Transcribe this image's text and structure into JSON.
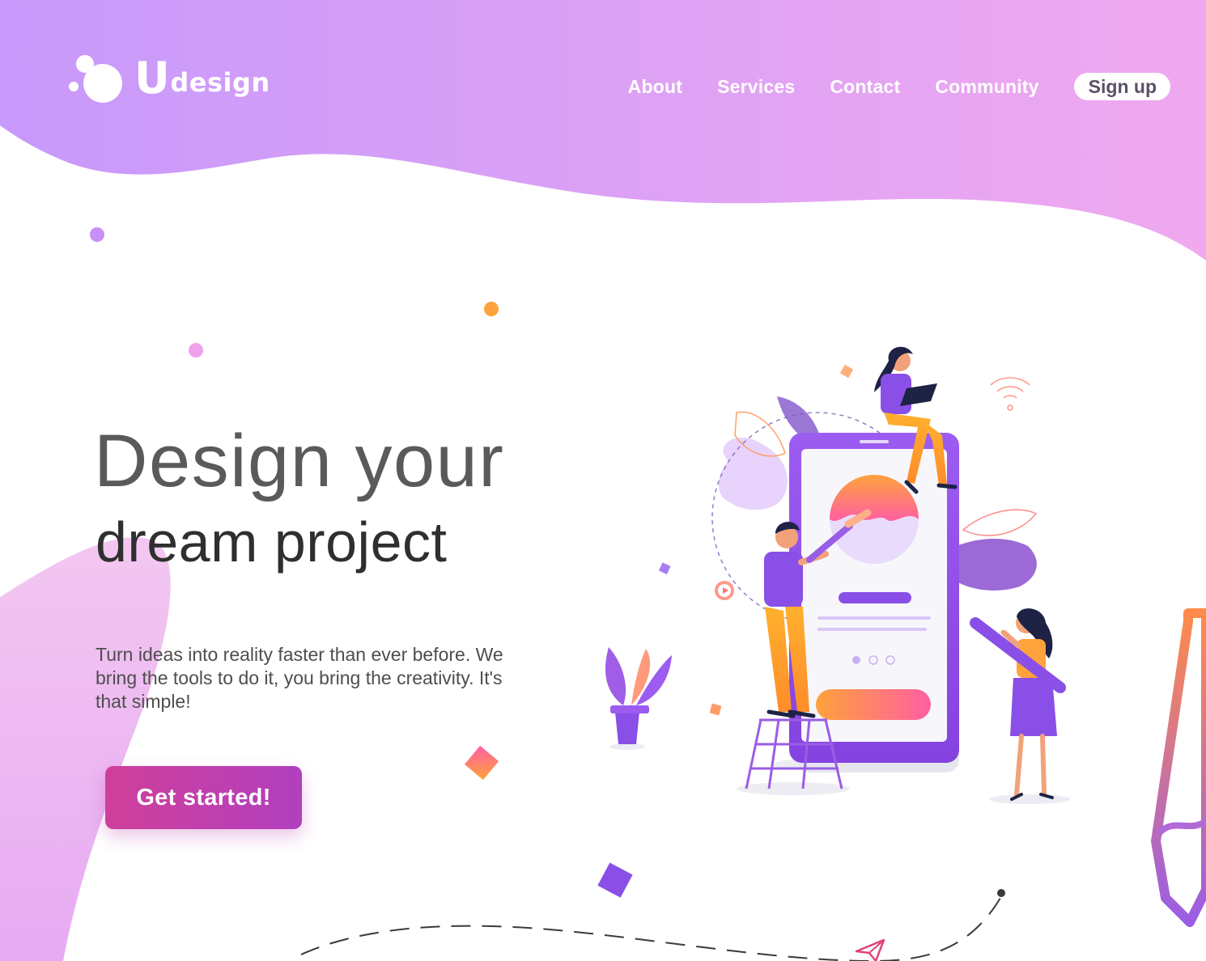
{
  "brand": {
    "name": "Udesign",
    "name_first": "U",
    "name_rest": "design",
    "logo_icon": "bubble-logo-icon"
  },
  "nav": {
    "links": [
      "About",
      "Services",
      "Contact",
      "Community"
    ],
    "signup_label": "Sign up"
  },
  "hero": {
    "title_line1": "Design your",
    "title_line2": "dream project",
    "description": "Turn ideas into reality faster than ever before. We bring the tools to do it, you bring the creativity. It's that simple!",
    "cta_label": "Get started!"
  },
  "colors": {
    "header_gradient_start": "#c997f8",
    "header_gradient_end": "#eeaaf0",
    "cta_start": "#cf3f9a",
    "cta_end": "#b23fbf",
    "accent_orange": "#ffa23b",
    "accent_purple": "#8a4fe6"
  },
  "illustration": {
    "subject": "people-designing-mobile-app-illustration",
    "icons": [
      "paintbrush-icon",
      "pencil-icon",
      "wifi-icon",
      "play-icon",
      "paper-plane-icon",
      "potted-plant-icon"
    ]
  }
}
